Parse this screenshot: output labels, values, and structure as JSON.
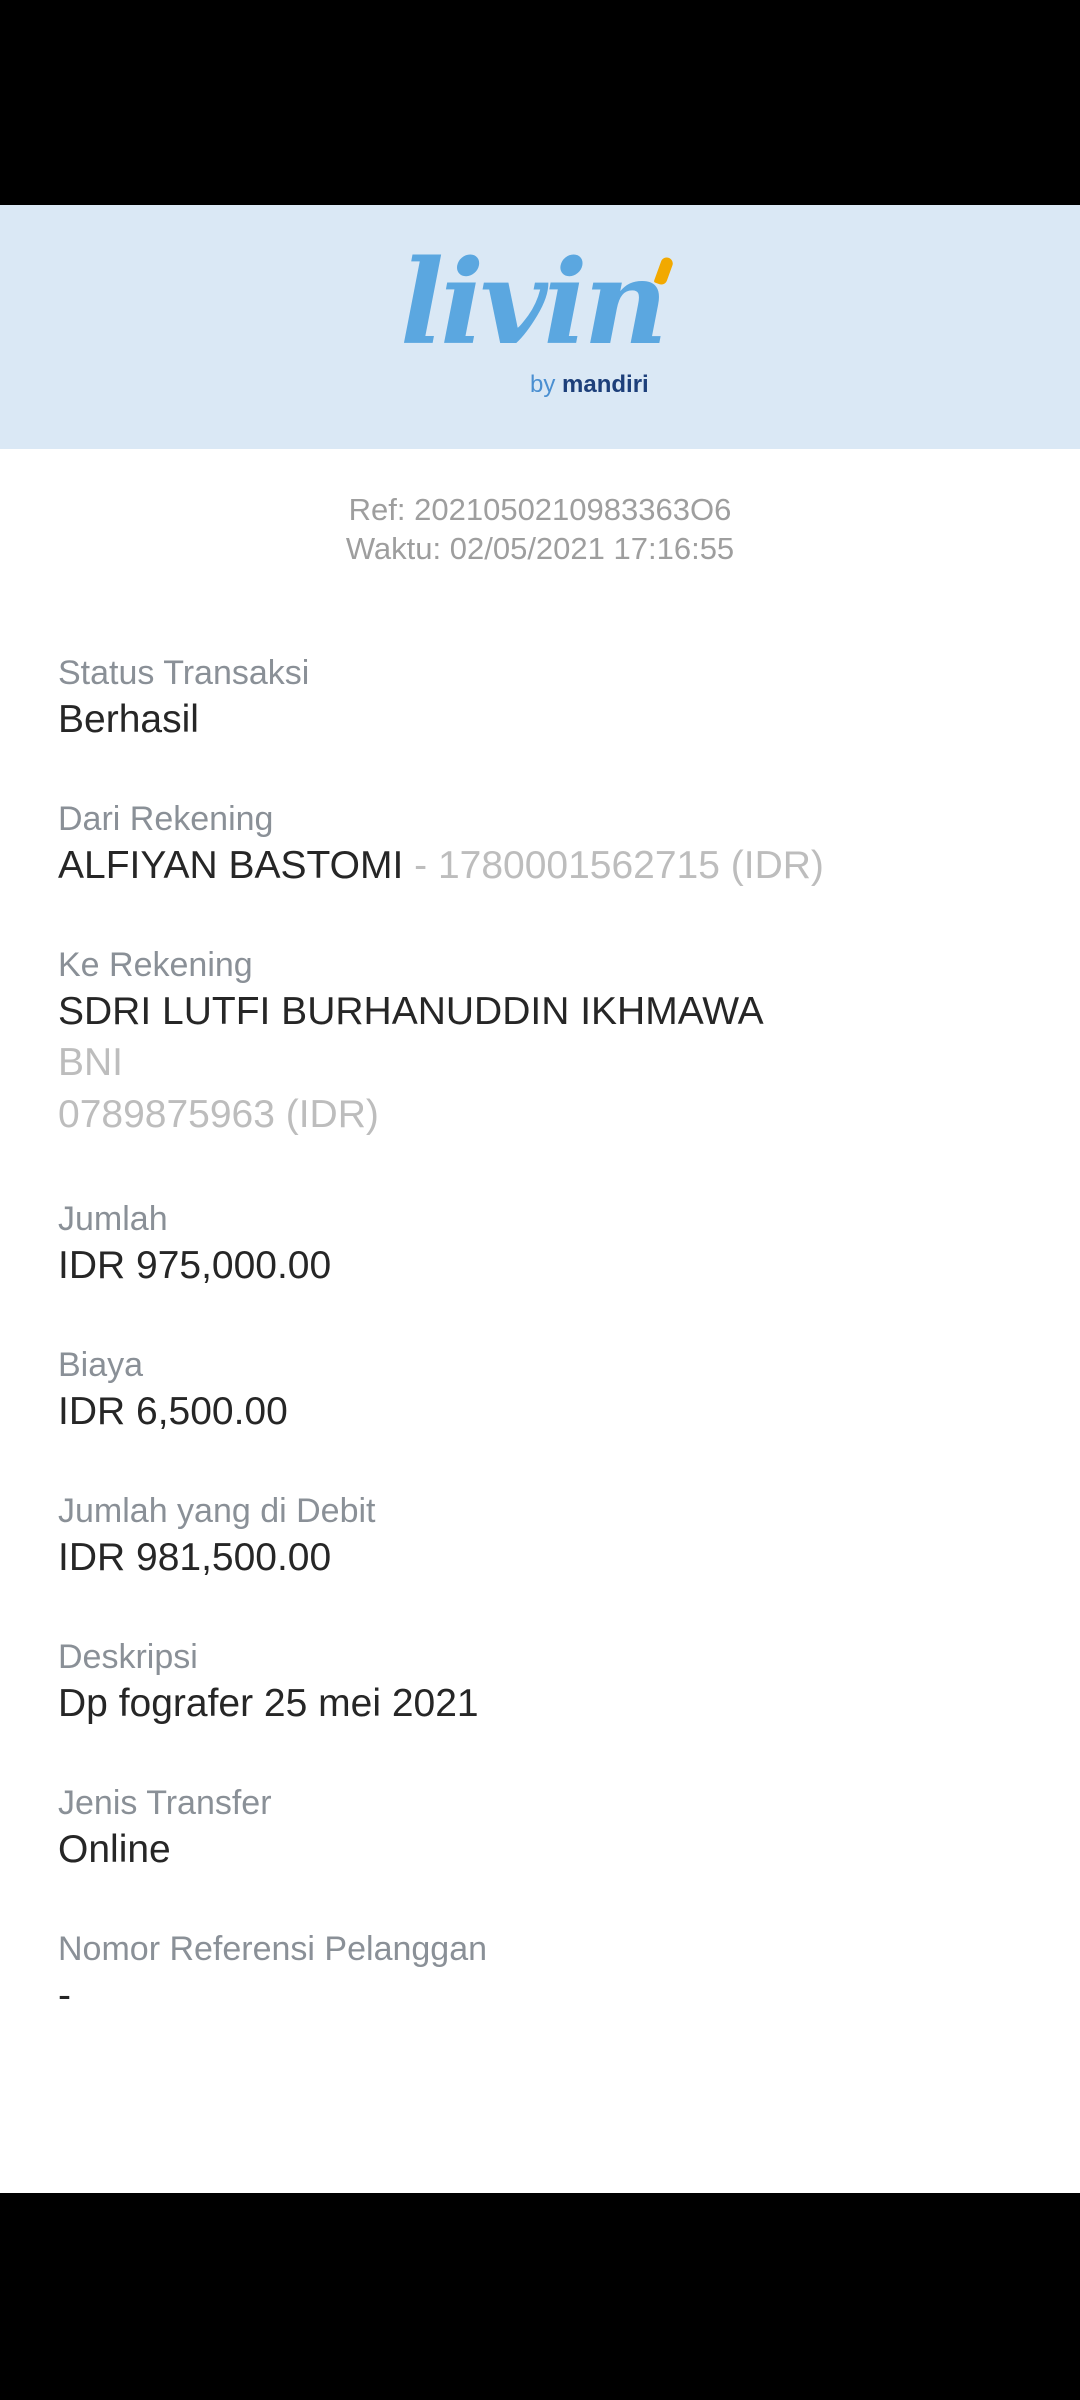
{
  "brand": {
    "logo_text": "livin",
    "logo_by": "by",
    "logo_company": "mandiri",
    "colors": {
      "header_bg": "#dae8f5",
      "logo_blue": "#5ba7e0",
      "accent_yellow": "#f2a900",
      "mandiri_navy": "#1d3f7a"
    }
  },
  "meta": {
    "ref": "Ref: 2021050210983363O6",
    "time": "Waktu: 02/05/2021 17:16:55"
  },
  "fields": {
    "status": {
      "label": "Status Transaksi",
      "value": "Berhasil"
    },
    "from": {
      "label": "Dari Rekening",
      "name": "ALFIYAN BASTOMI",
      "account": " - 1780001562715 (IDR)"
    },
    "to": {
      "label": "Ke Rekening",
      "name": "SDRI LUTFI BURHANUDDIN IKHMAWA",
      "bank": "BNI",
      "account": "0789875963 (IDR)"
    },
    "amount": {
      "label": "Jumlah",
      "value": "IDR 975,000.00"
    },
    "fee": {
      "label": "Biaya",
      "value": "IDR 6,500.00"
    },
    "debit": {
      "label": "Jumlah yang di Debit",
      "value": "IDR 981,500.00"
    },
    "description": {
      "label": "Deskripsi",
      "value": "Dp fografer 25 mei 2021"
    },
    "transfer_type": {
      "label": "Jenis Transfer",
      "value": "Online"
    },
    "customer_ref": {
      "label": "Nomor Referensi Pelanggan",
      "value": "-"
    }
  }
}
